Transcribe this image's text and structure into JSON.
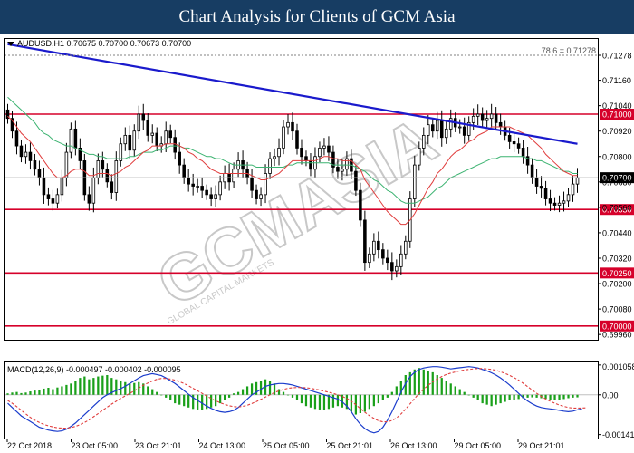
{
  "banner": {
    "title": "Chart Analysis for Clients of GCM Asia"
  },
  "chart_data": [
    {
      "type": "candlestick",
      "symbol_info": "AUDUSD,H1  0.70675 0.70700 0.70673 0.70700",
      "fib_label": "78.6 = 0.71278",
      "price_axis_ticks": [
        "0.71278",
        "0.71160",
        "0.71040",
        "0.70920",
        "0.70800",
        "0.70680",
        "0.70560",
        "0.70440",
        "0.70320",
        "0.70200",
        "0.70080",
        "0.69960"
      ],
      "ylim": [
        0.69935,
        0.71355
      ],
      "support_resistance": [
        0.71,
        0.7055,
        0.7025,
        0.7
      ],
      "support_resistance_labels": [
        "0.71000",
        "0.70550",
        "0.70250",
        "0.70000"
      ],
      "current_price": 0.707,
      "current_price_label": "0.70700",
      "time_labels": [
        "22 Oct 2018",
        "23 Oct 05:00",
        "23 Oct 21:01",
        "24 Oct 13:00",
        "25 Oct 05:00",
        "25 Oct 21:01",
        "26 Oct 13:00",
        "29 Oct 05:00",
        "29 Oct 21:01"
      ],
      "trendline": {
        "from": [
          0,
          0.7133
        ],
        "to": [
          126,
          0.7086
        ]
      },
      "close": [
        0.7098,
        0.7092,
        0.7085,
        0.708,
        0.7082,
        0.7078,
        0.7074,
        0.707,
        0.7062,
        0.706,
        0.7058,
        0.7062,
        0.707,
        0.7082,
        0.7093,
        0.7084,
        0.7078,
        0.7062,
        0.7058,
        0.707,
        0.7078,
        0.7074,
        0.7068,
        0.7063,
        0.7078,
        0.7086,
        0.709,
        0.7083,
        0.7092,
        0.71,
        0.7097,
        0.709,
        0.7091,
        0.7085,
        0.7086,
        0.7092,
        0.7089,
        0.7082,
        0.7076,
        0.707,
        0.7067,
        0.7066,
        0.7066,
        0.7064,
        0.7062,
        0.706,
        0.7062,
        0.7068,
        0.7072,
        0.7068,
        0.7074,
        0.7078,
        0.7074,
        0.707,
        0.7064,
        0.706,
        0.7062,
        0.7072,
        0.7079,
        0.708,
        0.7084,
        0.7094,
        0.7096,
        0.7092,
        0.7084,
        0.708,
        0.7078,
        0.7074,
        0.708,
        0.7084,
        0.7085,
        0.7082,
        0.7075,
        0.7073,
        0.7074,
        0.7079,
        0.7073,
        0.7064,
        0.705,
        0.703,
        0.7034,
        0.704,
        0.7036,
        0.7032,
        0.703,
        0.7026,
        0.7028,
        0.7034,
        0.704,
        0.706,
        0.7076,
        0.7084,
        0.709,
        0.7095,
        0.7092,
        0.7097,
        0.7089,
        0.7093,
        0.7098,
        0.7094,
        0.7094,
        0.709,
        0.7096,
        0.7099,
        0.71,
        0.7097,
        0.7098,
        0.71,
        0.7096,
        0.7094,
        0.709,
        0.7087,
        0.7086,
        0.7084,
        0.708,
        0.7076,
        0.707,
        0.7066,
        0.7065,
        0.706,
        0.7058,
        0.7057,
        0.7058,
        0.7059,
        0.7062,
        0.7067,
        0.707
      ],
      "ema_slow": [
        0.7108,
        0.7106,
        0.7104,
        0.7102,
        0.71,
        0.7098,
        0.7096,
        0.7093,
        0.7091,
        0.709,
        0.7088,
        0.7087,
        0.7086,
        0.7085,
        0.7085,
        0.7084,
        0.7083,
        0.7082,
        0.7081,
        0.7081,
        0.708,
        0.708,
        0.7079,
        0.7079,
        0.7079,
        0.7079,
        0.7079,
        0.708,
        0.708,
        0.7081,
        0.7082,
        0.7082,
        0.7082,
        0.7083,
        0.7083,
        0.7084,
        0.7085,
        0.7085,
        0.7085,
        0.7084,
        0.7084,
        0.7083,
        0.7082,
        0.7081,
        0.708,
        0.708,
        0.7079,
        0.7079,
        0.7078,
        0.7077,
        0.7076,
        0.7076,
        0.7076,
        0.7076,
        0.7076,
        0.7075,
        0.7075,
        0.7075,
        0.7075,
        0.7075,
        0.7075,
        0.7075,
        0.7076,
        0.7076,
        0.7077,
        0.7077,
        0.7077,
        0.7077,
        0.7077,
        0.7077,
        0.7077,
        0.7077,
        0.7076,
        0.7076,
        0.7076,
        0.7076,
        0.7076,
        0.7075,
        0.7074,
        0.7073,
        0.7071,
        0.7069,
        0.7068,
        0.7066,
        0.7064,
        0.7063,
        0.7061,
        0.7059,
        0.7058,
        0.7058,
        0.7058,
        0.7059,
        0.706,
        0.7061,
        0.7063,
        0.7065,
        0.7066,
        0.7068,
        0.707,
        0.7071,
        0.7072,
        0.7073,
        0.7074,
        0.7075,
        0.7076,
        0.7077,
        0.7078,
        0.7079,
        0.7079,
        0.708,
        0.708,
        0.708,
        0.708,
        0.708,
        0.708,
        0.7079,
        0.7079,
        0.7078,
        0.7078,
        0.7077,
        0.7076,
        0.7075,
        0.7074,
        0.7073,
        0.7073,
        0.7072,
        0.7072
      ],
      "ema_fast": [
        0.7099,
        0.7097,
        0.7094,
        0.7091,
        0.7089,
        0.7087,
        0.7084,
        0.7081,
        0.7078,
        0.7075,
        0.7072,
        0.707,
        0.707,
        0.7071,
        0.7073,
        0.7074,
        0.7074,
        0.7073,
        0.7071,
        0.7071,
        0.7072,
        0.7072,
        0.7072,
        0.7071,
        0.7072,
        0.7073,
        0.7075,
        0.7076,
        0.7078,
        0.708,
        0.7082,
        0.7083,
        0.7085,
        0.7085,
        0.7085,
        0.7086,
        0.7086,
        0.7086,
        0.7085,
        0.7084,
        0.7082,
        0.7081,
        0.7079,
        0.7078,
        0.7076,
        0.7074,
        0.7073,
        0.7072,
        0.7072,
        0.7072,
        0.7072,
        0.7072,
        0.7072,
        0.7072,
        0.7071,
        0.707,
        0.7069,
        0.7069,
        0.707,
        0.7071,
        0.7072,
        0.7074,
        0.7076,
        0.7078,
        0.7078,
        0.7078,
        0.7078,
        0.7078,
        0.7078,
        0.7079,
        0.708,
        0.708,
        0.7079,
        0.7079,
        0.7078,
        0.7078,
        0.7078,
        0.7076,
        0.7074,
        0.7069,
        0.7066,
        0.7063,
        0.706,
        0.7057,
        0.7054,
        0.7052,
        0.705,
        0.7048,
        0.7048,
        0.705,
        0.7053,
        0.7057,
        0.7061,
        0.7065,
        0.7068,
        0.7072,
        0.7074,
        0.7077,
        0.708,
        0.7082,
        0.7083,
        0.7085,
        0.7087,
        0.7088,
        0.709,
        0.7091,
        0.7092,
        0.7094,
        0.7094,
        0.7094,
        0.7094,
        0.7094,
        0.7093,
        0.7092,
        0.7091,
        0.709,
        0.7088,
        0.7086,
        0.7084,
        0.7081,
        0.7079,
        0.7077,
        0.7075,
        0.7073,
        0.7072,
        0.7071,
        0.7071
      ],
      "watermark": {
        "main": "GCMASIA",
        "sub": "GLOBAL CAPITAL MARKETS"
      }
    },
    {
      "type": "macd",
      "label": "MACD(12,26,9) -0.000497 -0.000402 -0.000095",
      "axis_ticks": [
        "0.001058",
        "0.00",
        "-0.001410"
      ],
      "ylim": [
        -0.00155,
        0.00115
      ],
      "histogram": [
        5e-05,
        8e-05,
        0.0001,
        6e-05,
        8e-05,
        0.00012,
        0.00015,
        0.00018,
        0.00022,
        0.00025,
        0.0002,
        0.00026,
        0.0003,
        0.00035,
        0.0004,
        0.0005,
        0.0006,
        0.00065,
        0.00055,
        0.0006,
        0.00065,
        0.00068,
        0.0007,
        0.0006,
        0.00055,
        0.0005,
        0.00045,
        0.0004,
        0.00042,
        0.00045,
        0.0004,
        0.0003,
        0.0002,
        0.0001,
        0.0,
        -0.0001,
        -0.0002,
        -0.0003,
        -0.00035,
        -0.0004,
        -0.00045,
        -0.0005,
        -0.00052,
        -0.00055,
        -0.0005,
        -0.00045,
        -0.0004,
        -0.0003,
        -0.0002,
        -0.0001,
        5e-05,
        0.0001,
        0.0002,
        0.0003,
        0.0004,
        0.00045,
        0.0005,
        0.00055,
        0.0005,
        0.0004,
        0.0002,
        0.0001,
        0.0,
        -0.0001,
        -0.0002,
        -0.0003,
        -0.0004,
        -0.00045,
        -0.0005,
        -0.00052,
        -0.00055,
        -0.0005,
        -0.00045,
        -0.0004,
        -0.00045,
        -0.0005,
        -0.0006,
        -0.0007,
        -0.00065,
        -0.0006,
        -0.0005,
        -0.0004,
        -0.0003,
        -0.0002,
        -0.0001,
        0.0001,
        0.0003,
        0.0005,
        0.0007,
        0.0008,
        0.0009,
        0.00095,
        0.0009,
        0.00085,
        0.0008,
        0.0007,
        0.0006,
        0.0005,
        0.0004,
        0.0003,
        0.0002,
        0.0001,
        0.0,
        -0.0001,
        -0.0002,
        -0.0003,
        -0.00035,
        -0.0004,
        -0.00035,
        -0.0003,
        -0.00025,
        -0.0002,
        -0.00018,
        -0.00015,
        -0.00012,
        -0.0001,
        -9e-05,
        -0.0001,
        -0.00012,
        -0.00015,
        -0.00018,
        -0.0002,
        -0.00018,
        -0.00015,
        -0.00012,
        -0.0001,
        -9e-05
      ],
      "macd_line": [
        -0.0003,
        -0.00045,
        -0.0006,
        -0.00075,
        -0.00085,
        -0.00095,
        -0.00105,
        -0.00115,
        -0.0012,
        -0.00125,
        -0.00128,
        -0.0013,
        -0.00128,
        -0.00122,
        -0.00112,
        -0.001,
        -0.00085,
        -0.0007,
        -0.00055,
        -0.0004,
        -0.00025,
        -0.0001,
        0.0,
        8e-05,
        0.00015,
        0.00022,
        0.0003,
        0.0004,
        0.0005,
        0.0006,
        0.00068,
        0.00072,
        0.00075,
        0.00072,
        0.00068,
        0.0006,
        0.0005,
        0.0004,
        0.00028,
        0.00015,
        2e-05,
        -0.0001,
        -0.0002,
        -0.0003,
        -0.0004,
        -0.00048,
        -0.00055,
        -0.0006,
        -0.00062,
        -0.0006,
        -0.00055,
        -0.00045,
        -0.0003,
        -0.00015,
        0.0,
        0.0001,
        0.0002,
        0.0003,
        0.00035,
        0.00038,
        0.0004,
        0.0004,
        0.00038,
        0.00035,
        0.0003,
        0.00025,
        0.0002,
        0.00015,
        0.0001,
        5e-05,
        0.0,
        -5e-05,
        -0.0001,
        -0.00015,
        -0.00025,
        -0.0004,
        -0.0006,
        -0.00085,
        -0.00105,
        -0.0012,
        -0.0013,
        -0.00135,
        -0.0013,
        -0.00115,
        -0.0009,
        -0.0006,
        -0.00025,
        0.0001,
        0.0004,
        0.00065,
        0.0008,
        0.0009,
        0.00095,
        0.00098,
        0.001,
        0.001,
        0.00098,
        0.00095,
        0.00092,
        0.00094,
        0.00096,
        0.00098,
        0.001,
        0.00098,
        0.00095,
        0.0009,
        0.00085,
        0.00078,
        0.0007,
        0.0006,
        0.00048,
        0.00035,
        0.0002,
        5e-05,
        -0.0001,
        -0.00022,
        -0.00032,
        -0.0004,
        -0.00045,
        -0.00048,
        -0.0005,
        -0.00052,
        -0.00055,
        -0.00058,
        -0.0006,
        -0.00058,
        -0.00053,
        -0.0005
      ],
      "signal_line": [
        -0.0002,
        -0.0003,
        -0.00042,
        -0.00055,
        -0.00068,
        -0.0008,
        -0.0009,
        -0.00098,
        -0.00105,
        -0.0011,
        -0.00114,
        -0.00117,
        -0.00118,
        -0.00118,
        -0.00116,
        -0.00112,
        -0.00106,
        -0.00098,
        -0.00089,
        -0.00078,
        -0.00067,
        -0.00055,
        -0.00044,
        -0.00033,
        -0.00023,
        -0.00013,
        -4e-05,
        5e-05,
        0.00014,
        0.00024,
        0.00034,
        0.00042,
        0.00049,
        0.00055,
        0.00058,
        0.00058,
        0.00056,
        0.00052,
        0.00047,
        0.0004,
        0.00032,
        0.00023,
        0.00014,
        5e-05,
        -4e-05,
        -0.00013,
        -0.00021,
        -0.00028,
        -0.00034,
        -0.00039,
        -0.00042,
        -0.00043,
        -0.00041,
        -0.00037,
        -0.00031,
        -0.00024,
        -0.00016,
        -8e-05,
        0.0,
        8e-05,
        0.00014,
        0.00019,
        0.00023,
        0.00025,
        0.00026,
        0.00026,
        0.00025,
        0.00023,
        0.0002,
        0.00017,
        0.00013,
        9e-05,
        5e-05,
        0.0,
        -6e-05,
        -0.00013,
        -0.00023,
        -0.00035,
        -0.00049,
        -0.00062,
        -0.00074,
        -0.00084,
        -0.00092,
        -0.00096,
        -0.00096,
        -0.00091,
        -0.00082,
        -0.00068,
        -0.00051,
        -0.00032,
        -0.00013,
        5e-05,
        0.0002,
        0.00034,
        0.00046,
        0.00056,
        0.00065,
        0.00072,
        0.00077,
        0.00081,
        0.00085,
        0.00088,
        0.0009,
        0.00092,
        0.00093,
        0.00093,
        0.00092,
        0.0009,
        0.00087,
        0.00082,
        0.00076,
        0.00069,
        0.00061,
        0.00052,
        0.00041,
        0.00029,
        0.00017,
        5e-05,
        -6e-05,
        -0.00015,
        -0.00023,
        -0.0003,
        -0.00036,
        -0.00041,
        -0.00045,
        -0.00047,
        -0.00047,
        -0.00047,
        -0.00046
      ]
    }
  ]
}
